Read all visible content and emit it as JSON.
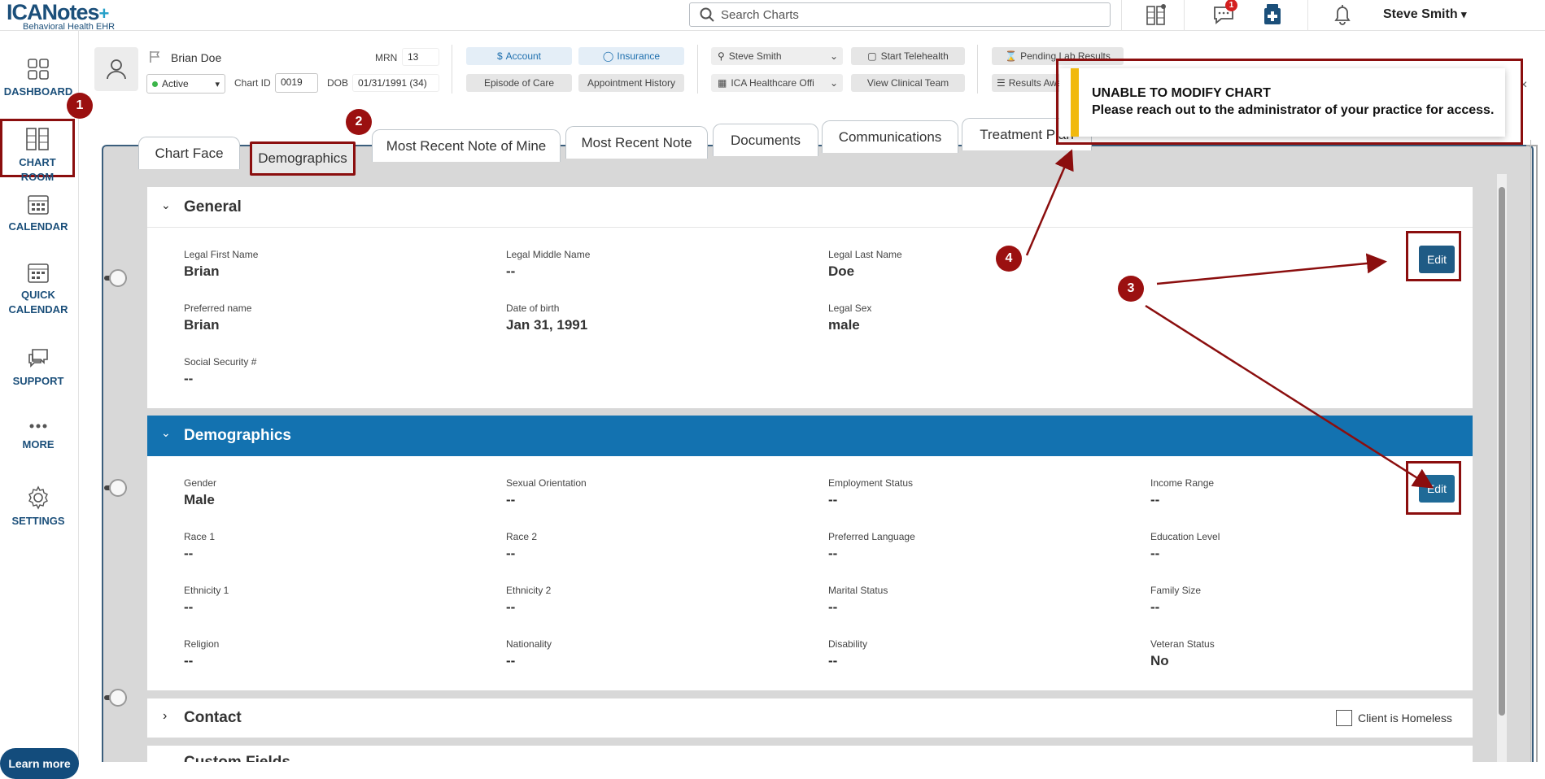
{
  "brand": {
    "name": "ICANotes",
    "subtitle": "Behavioral Health EHR"
  },
  "search": {
    "placeholder": "Search Charts"
  },
  "topbar": {
    "messages_badge": "1",
    "user_name": "Steve Smith"
  },
  "sidebar": {
    "items": [
      {
        "label": "DASHBOARD",
        "icon": "dashboard-icon"
      },
      {
        "label": "CHART ROOM",
        "icon": "file-cabinet-icon"
      },
      {
        "label": "CALENDAR",
        "icon": "calendar-icon"
      },
      {
        "label": "QUICK CALENDAR",
        "icon": "quick-calendar-icon"
      },
      {
        "label": "SUPPORT",
        "icon": "chat-icon"
      },
      {
        "label": "MORE",
        "icon": "more-icon"
      },
      {
        "label": "SETTINGS",
        "icon": "gear-icon"
      }
    ],
    "learn_more": "Learn more"
  },
  "patient": {
    "name": "Brian Doe",
    "status": "Active",
    "chart_id_label": "Chart ID",
    "chart_id": "0019",
    "mrn_label": "MRN",
    "mrn": "13",
    "dob_label": "DOB",
    "dob": "01/31/1991 (34)"
  },
  "header_buttons": {
    "account": "Account",
    "insurance": "Insurance",
    "episode": "Episode of Care",
    "appointment_history": "Appointment History",
    "provider": "Steve Smith",
    "facility": "ICA Healthcare Offi",
    "start_telehealth": "Start Telehealth",
    "view_clinical_team": "View Clinical Team",
    "pending_lab": "Pending Lab Results",
    "results_await": "Results Await"
  },
  "tabs": [
    "Chart Face",
    "Demographics",
    "Most Recent Note of Mine",
    "Most Recent Note",
    "Documents",
    "Communications",
    "Treatment Plan"
  ],
  "toast": {
    "title": "UNABLE TO MODIFY CHART",
    "message": "Please reach out to the administrator of your practice for access."
  },
  "general": {
    "title": "General",
    "edit": "Edit",
    "fields": [
      {
        "label": "Legal First Name",
        "value": "Brian"
      },
      {
        "label": "Legal Middle Name",
        "value": "--"
      },
      {
        "label": "Legal Last Name",
        "value": "Doe"
      },
      {
        "label": "Preferred name",
        "value": "Brian"
      },
      {
        "label": "Date of birth",
        "value": "Jan 31, 1991"
      },
      {
        "label": "Legal Sex",
        "value": "male"
      },
      {
        "label": "Social Security #",
        "value": "--"
      }
    ]
  },
  "demographics": {
    "title": "Demographics",
    "edit": "Edit",
    "fields": [
      {
        "label": "Gender",
        "value": "Male"
      },
      {
        "label": "Sexual Orientation",
        "value": "--"
      },
      {
        "label": "Employment Status",
        "value": "--"
      },
      {
        "label": "Income Range",
        "value": "--"
      },
      {
        "label": "Race 1",
        "value": "--"
      },
      {
        "label": "Race 2",
        "value": "--"
      },
      {
        "label": "Preferred Language",
        "value": "--"
      },
      {
        "label": "Education Level",
        "value": "--"
      },
      {
        "label": "Ethnicity 1",
        "value": "--"
      },
      {
        "label": "Ethnicity 2",
        "value": "--"
      },
      {
        "label": "Marital Status",
        "value": "--"
      },
      {
        "label": "Family Size",
        "value": "--"
      },
      {
        "label": "Religion",
        "value": "--"
      },
      {
        "label": "Nationality",
        "value": "--"
      },
      {
        "label": "Disability",
        "value": "--"
      },
      {
        "label": "Veteran Status",
        "value": "No"
      }
    ]
  },
  "contact": {
    "title": "Contact",
    "homeless_label": "Client is Homeless"
  },
  "custom_fields": {
    "title": "Custom Fields"
  },
  "annotations": [
    "1",
    "2",
    "3",
    "4"
  ],
  "colors": {
    "brand": "#1b4f7a",
    "accent": "#1372b0",
    "annotation": "#8b0e0e",
    "toast_bar": "#f1b90d"
  }
}
